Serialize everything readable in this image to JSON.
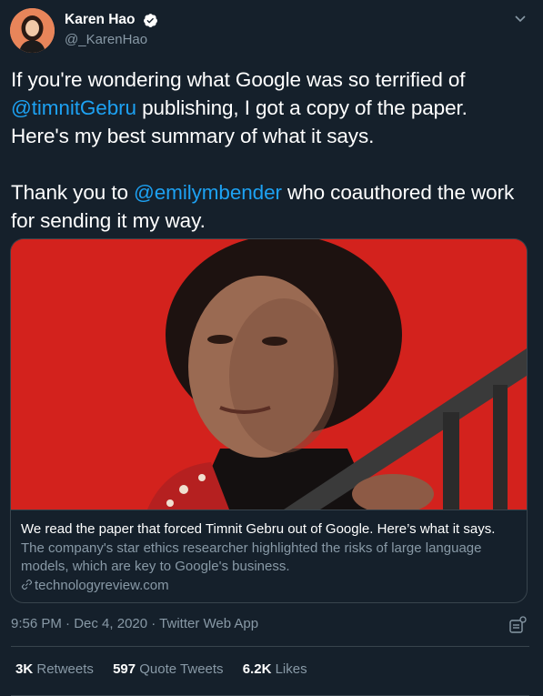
{
  "author": {
    "display_name": "Karen Hao",
    "handle": "@_KarenHao",
    "verified": true
  },
  "tweet": {
    "para1": {
      "before": "If you're wondering what Google was so terrified of ",
      "mention": "@timnitGebru",
      "after": " publishing, I got a copy of the paper. Here's my best summary of what it says."
    },
    "para2": {
      "before": "Thank you to ",
      "mention": "@emilymbender",
      "after": " who coauthored the work for sending it my way."
    }
  },
  "card": {
    "title": "We read the paper that forced Timnit Gebru out of Google. Here’s what it says.",
    "description": "The company's star ethics researcher highlighted the risks of large language models, which are key to Google's business.",
    "domain": "technologyreview.com"
  },
  "meta": {
    "time": "9:56 PM",
    "sep1": " · ",
    "date": "Dec 4, 2020",
    "sep2": " · ",
    "source": "Twitter Web App"
  },
  "stats": {
    "retweets_count": "3K",
    "retweets_label": "Retweets",
    "quotes_count": "597",
    "quotes_label": "Quote Tweets",
    "likes_count": "6.2K",
    "likes_label": "Likes"
  },
  "colors": {
    "background": "#15202b",
    "link": "#1da1f2",
    "secondary_text": "#8899a6",
    "border": "#38444d",
    "card_image_bg": "#d9231e"
  }
}
